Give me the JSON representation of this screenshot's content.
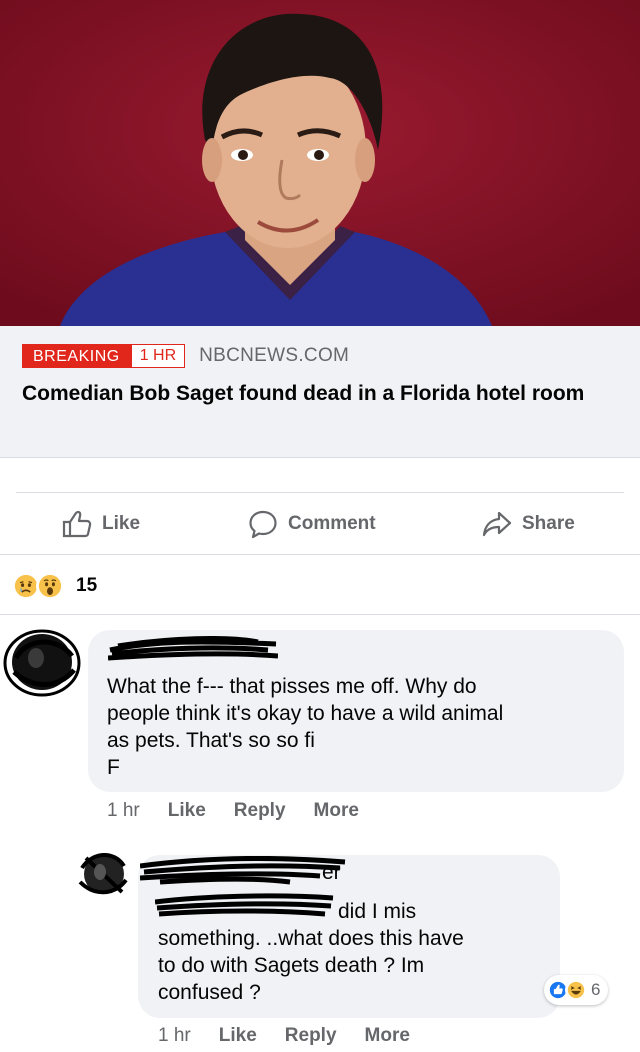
{
  "post": {
    "image_alt": "Portrait of a smiling man with dark hair in a blue sweater against a red background"
  },
  "link_preview": {
    "breaking_label": "BREAKING",
    "time_label": "1 HR",
    "source": "NBCNEWS.COM",
    "headline": "Comedian Bob Saget found dead in a Florida hotel room"
  },
  "actions": {
    "like_label": "Like",
    "comment_label": "Comment",
    "share_label": "Share"
  },
  "reactions": {
    "emojis": [
      "sad-emoji",
      "wow-emoji"
    ],
    "count": "15"
  },
  "comments": [
    {
      "author_redacted": true,
      "text": "What the f--- that pisses me off. Why do people think it's okay to have a wild animal as pets. That's so so fi F",
      "lines": [
        "What the f--- that pisses me off. Why do",
        "people think it's okay to have a wild animal",
        "as pets. That's so so fi",
        "F"
      ],
      "time": "1 hr",
      "like_label": "Like",
      "reply_label": "Reply",
      "more_label": "More"
    },
    {
      "author_redacted": true,
      "author_fragment": "er",
      "lines": [
        "did I mis",
        "something. ..what does this have",
        "to do with Sagets death ? Im",
        "confused ?"
      ],
      "time": "1 hr",
      "like_label": "Like",
      "reply_label": "Reply",
      "more_label": "More",
      "reactions": {
        "emojis": [
          "like-emoji",
          "haha-emoji"
        ],
        "count": "6"
      }
    }
  ],
  "colors": {
    "photo_background": "#7e0f22",
    "breaking_red": "#e1261c",
    "bubble_gray": "#f0f2f5",
    "secondary_text": "#65676b",
    "like_blue": "#1877f2"
  }
}
